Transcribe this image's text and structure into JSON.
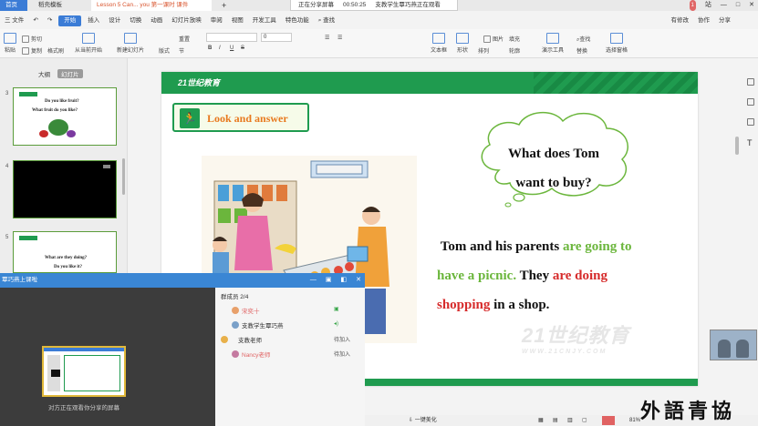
{
  "titlebar": {
    "tabs": [
      {
        "label": "首页"
      },
      {
        "label": "稻壳模板"
      },
      {
        "label": "Lesson 5 Can... you 第一课时 课件"
      },
      {
        "label": "+"
      }
    ],
    "share_status": "正在分享屏幕",
    "share_time": "00:50:25",
    "watch_text": "支教学生覃巧燕正在观看",
    "notify_badge": "1",
    "user_label": "站"
  },
  "menu": {
    "file": "三 文件",
    "items": [
      "开始",
      "插入",
      "设计",
      "切换",
      "动画",
      "幻灯片放映",
      "审阅",
      "视图",
      "开发工具",
      "特色功能"
    ],
    "active": "开始",
    "search": "查找",
    "right": [
      "有修改",
      "协作",
      "分享"
    ]
  },
  "ribbon": {
    "paste": "粘贴",
    "cut": "剪切",
    "copy": "复制",
    "format_painter": "格式刷",
    "from_current": "从当前开始",
    "new_slide": "新建幻灯片",
    "layout": "版式",
    "section": "节",
    "reset": "重置",
    "font_size": "0",
    "textbox": "文本框",
    "shape": "形状",
    "arrange": "排列",
    "picture": "图片",
    "fill": "填充",
    "outline": "轮廓",
    "presenter_tools": "演示工具",
    "find": "查找",
    "replace": "替换",
    "select_pane": "选择窗格"
  },
  "leftpane": {
    "tab_outline": "大纲",
    "tab_slides": "幻灯片",
    "slides": [
      {
        "number": "3",
        "line1": "Do you like fruit?",
        "line2": "What fruit do you like?"
      },
      {
        "number": "4"
      },
      {
        "number": "5",
        "line1": "What are they doing?",
        "line2": "Do you like it?"
      }
    ]
  },
  "slide": {
    "logo": "21世纪教育",
    "badge": "Look and answer",
    "question_line1": "What does Tom",
    "question_line2": "want to buy?",
    "story": {
      "p1": "Tom and his parents ",
      "p2": "are going to",
      "p3": "have a picnic.",
      "p4": " They ",
      "p5": "are doing",
      "p6": "shopping",
      "p7": " in a shop."
    },
    "watermark": "21世纪教育",
    "watermark_url": "WWW.21CNJY.COM"
  },
  "overlay": {
    "title": "覃巧燕上课啦",
    "members_header": "群成员 2/4",
    "caption": "对方正在观看你分享的屏幕",
    "members": [
      {
        "name": "宋奕十",
        "status": "",
        "color": "#e06666"
      },
      {
        "name": "支教学生覃巧燕",
        "status": "",
        "color": "#555555"
      },
      {
        "name": "支教老师",
        "status": "待加入",
        "color": "#555555"
      },
      {
        "name": "Nancy老师",
        "status": "待加入",
        "color": "#e06666"
      }
    ]
  },
  "statusbar": {
    "beautify": "一键美化",
    "zoom": "81%"
  },
  "brand": "外語青協"
}
